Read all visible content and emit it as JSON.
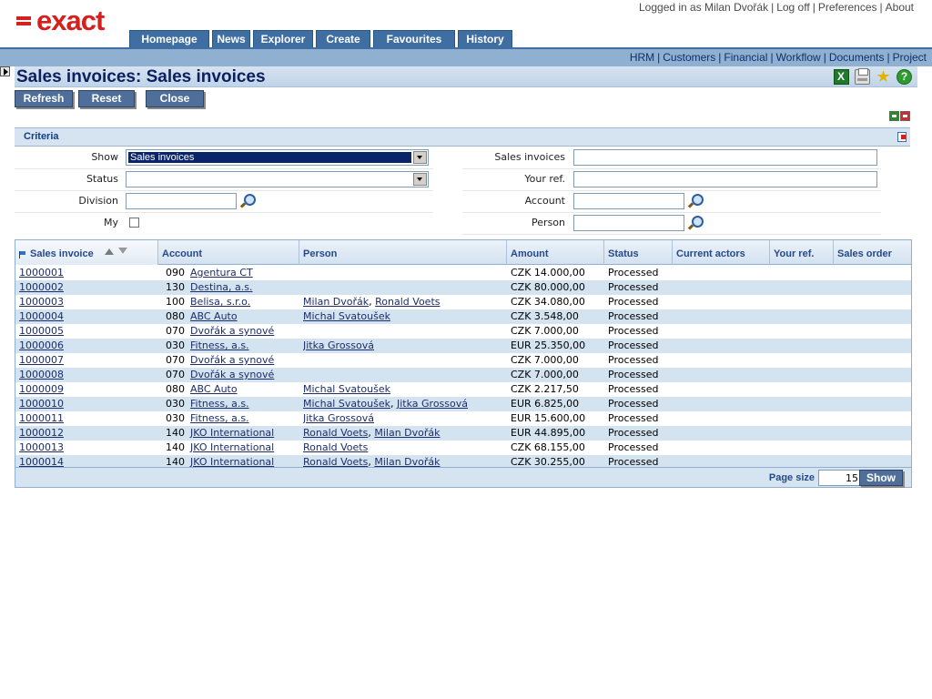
{
  "header": {
    "logo_text": "exact",
    "user_text": "Logged in as Milan Dvořák",
    "links": [
      "Log off",
      "Preferences",
      "About"
    ]
  },
  "main_nav": [
    "Homepage",
    "News",
    "Explorer",
    "Create",
    "Favourites",
    "History"
  ],
  "sub_nav": [
    "HRM",
    "Customers",
    "Financial",
    "Workflow",
    "Documents",
    "Project"
  ],
  "page": {
    "title": "Sales invoices: Sales invoices"
  },
  "actions": {
    "refresh": "Refresh",
    "reset": "Reset",
    "close": "Close"
  },
  "criteria": {
    "title": "Criteria",
    "show": {
      "label": "Show",
      "value": "Sales invoices"
    },
    "status": {
      "label": "Status",
      "value": ""
    },
    "division": {
      "label": "Division",
      "value": ""
    },
    "my": {
      "label": "My"
    },
    "sales_invoices": {
      "label": "Sales invoices",
      "value": ""
    },
    "your_ref": {
      "label": "Your ref.",
      "value": ""
    },
    "account": {
      "label": "Account",
      "value": ""
    },
    "person": {
      "label": "Person",
      "value": ""
    }
  },
  "table": {
    "columns": [
      "Sales invoice",
      "Account",
      "Person",
      "Amount",
      "Status",
      "Current actors",
      "Your ref.",
      "Sales order"
    ],
    "rows": [
      {
        "invoice": "1000001",
        "code": "090",
        "account": "Agentura CT",
        "persons": [],
        "amount": "CZK 14.000,00",
        "status": "Processed"
      },
      {
        "invoice": "1000002",
        "code": "130",
        "account": "Destina, a.s.",
        "persons": [],
        "amount": "CZK 80.000,00",
        "status": "Processed"
      },
      {
        "invoice": "1000003",
        "code": "100",
        "account": "Belisa, s.r.o.",
        "persons": [
          "Milan Dvořák",
          "Ronald Voets"
        ],
        "amount": "CZK 34.080,00",
        "status": "Processed"
      },
      {
        "invoice": "1000004",
        "code": "080",
        "account": "ABC Auto",
        "persons": [
          "Michal Svatoušek"
        ],
        "amount": "CZK 3.548,00",
        "status": "Processed"
      },
      {
        "invoice": "1000005",
        "code": "070",
        "account": "Dvořák a synové",
        "persons": [],
        "amount": "CZK 7.000,00",
        "status": "Processed"
      },
      {
        "invoice": "1000006",
        "code": "030",
        "account": "Fitness, a.s.",
        "persons": [
          "Jitka Grossová"
        ],
        "amount": "EUR 25.350,00",
        "status": "Processed"
      },
      {
        "invoice": "1000007",
        "code": "070",
        "account": "Dvořák a synové",
        "persons": [],
        "amount": "CZK 7.000,00",
        "status": "Processed"
      },
      {
        "invoice": "1000008",
        "code": "070",
        "account": "Dvořák a synové",
        "persons": [],
        "amount": "CZK 7.000,00",
        "status": "Processed"
      },
      {
        "invoice": "1000009",
        "code": "080",
        "account": "ABC Auto",
        "persons": [
          "Michal Svatoušek"
        ],
        "amount": "CZK 2.217,50",
        "status": "Processed"
      },
      {
        "invoice": "1000010",
        "code": "030",
        "account": "Fitness, a.s.",
        "persons": [
          "Michal Svatoušek",
          "Jitka Grossová"
        ],
        "amount": "EUR 6.825,00",
        "status": "Processed"
      },
      {
        "invoice": "1000011",
        "code": "030",
        "account": "Fitness, a.s.",
        "persons": [
          "Jitka Grossová"
        ],
        "amount": "EUR 15.600,00",
        "status": "Processed"
      },
      {
        "invoice": "1000012",
        "code": "140",
        "account": "JKO International",
        "persons": [
          "Ronald Voets",
          "Milan Dvořák"
        ],
        "amount": "EUR 44.895,00",
        "status": "Processed"
      },
      {
        "invoice": "1000013",
        "code": "140",
        "account": "JKO International",
        "persons": [
          "Ronald Voets"
        ],
        "amount": "CZK 68.155,00",
        "status": "Processed"
      },
      {
        "invoice": "1000014",
        "code": "140",
        "account": "JKO International",
        "persons": [
          "Ronald Voets",
          "Milan Dvořák"
        ],
        "amount": "CZK 30.255,00",
        "status": "Processed"
      }
    ]
  },
  "footer": {
    "page_size_label": "Page size",
    "page_size": "15",
    "show_label": "Show"
  }
}
